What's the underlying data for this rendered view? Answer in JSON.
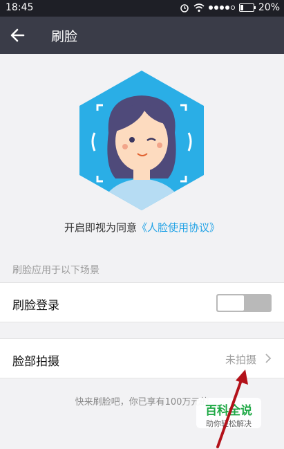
{
  "status_bar": {
    "time": "18:45",
    "battery": "20%"
  },
  "nav": {
    "title": "刷脸",
    "back_icon": "back-arrow-icon"
  },
  "hero": {
    "colors": {
      "hex": "#2aaee6",
      "skin": "#fddbbf",
      "hair": "#4f4a7a",
      "shirt": "#b6dcf3"
    }
  },
  "consent": {
    "prefix": "开启即视为同意",
    "link": "《人脸使用协议》"
  },
  "section_header": "刷脸应用于以下场景",
  "rows": [
    {
      "label": "刷脸登录",
      "toggle_on": false
    },
    {
      "label": "脸部拍摄",
      "value": "未拍摄"
    }
  ],
  "footer_text": "快来刷脸吧，你已享有100万元的",
  "watermark": {
    "title": "百科全说",
    "subtitle": "助你轻松解决"
  },
  "colors": {
    "accent": "#23a3e6",
    "nav_bg": "#3a3c48",
    "status_bg": "#1e1f26",
    "page_bg": "#f2f2f4"
  }
}
